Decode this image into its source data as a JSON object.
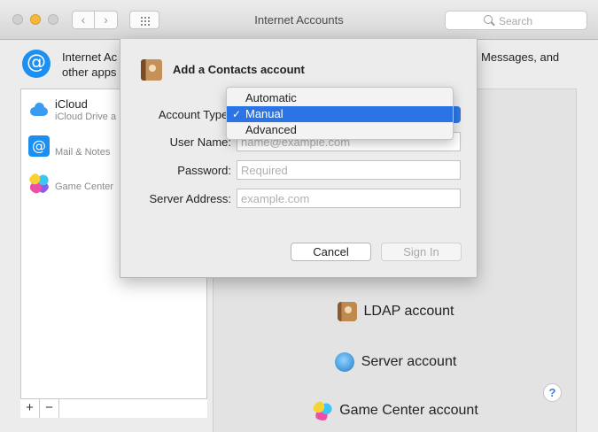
{
  "window": {
    "title": "Internet Accounts"
  },
  "toolbar": {
    "back_label": "‹",
    "forward_label": "›",
    "search_placeholder": "Search"
  },
  "header": {
    "icon": "at-sign-icon",
    "description_left": "Internet Ac\nother apps",
    "description_right": "Messages, and"
  },
  "accounts": [
    {
      "name": "iCloud",
      "detail": "iCloud Drive a",
      "icon": "icloud-icon"
    },
    {
      "name": "",
      "detail": "Mail & Notes",
      "icon": "at-sign-icon"
    },
    {
      "name": "",
      "detail": "Game Center",
      "icon": "game-center-icon"
    }
  ],
  "list_controls": {
    "add_label": "+",
    "remove_label": "−"
  },
  "providers": [
    {
      "label": "LDAP account",
      "icon": "contacts-book-icon"
    },
    {
      "label": "Server account",
      "icon": "globe-icon"
    },
    {
      "label": "Game Center account",
      "icon": "game-center-icon"
    }
  ],
  "help_label": "?",
  "dialog": {
    "title": "Add a Contacts account",
    "account_type_label": "Account Type:",
    "user_name_label": "User Name:",
    "user_name_placeholder": "name@example.com",
    "password_label": "Password:",
    "password_placeholder": "Required",
    "server_label": "Server Address:",
    "server_placeholder": "example.com",
    "cancel_label": "Cancel",
    "signin_label": "Sign In"
  },
  "account_type_menu": {
    "options": [
      "Automatic",
      "Manual",
      "Advanced"
    ],
    "selected": "Manual",
    "check": "✓"
  },
  "colors": {
    "accent": "#2b74e6",
    "app_blue": "#1c8ff2"
  }
}
